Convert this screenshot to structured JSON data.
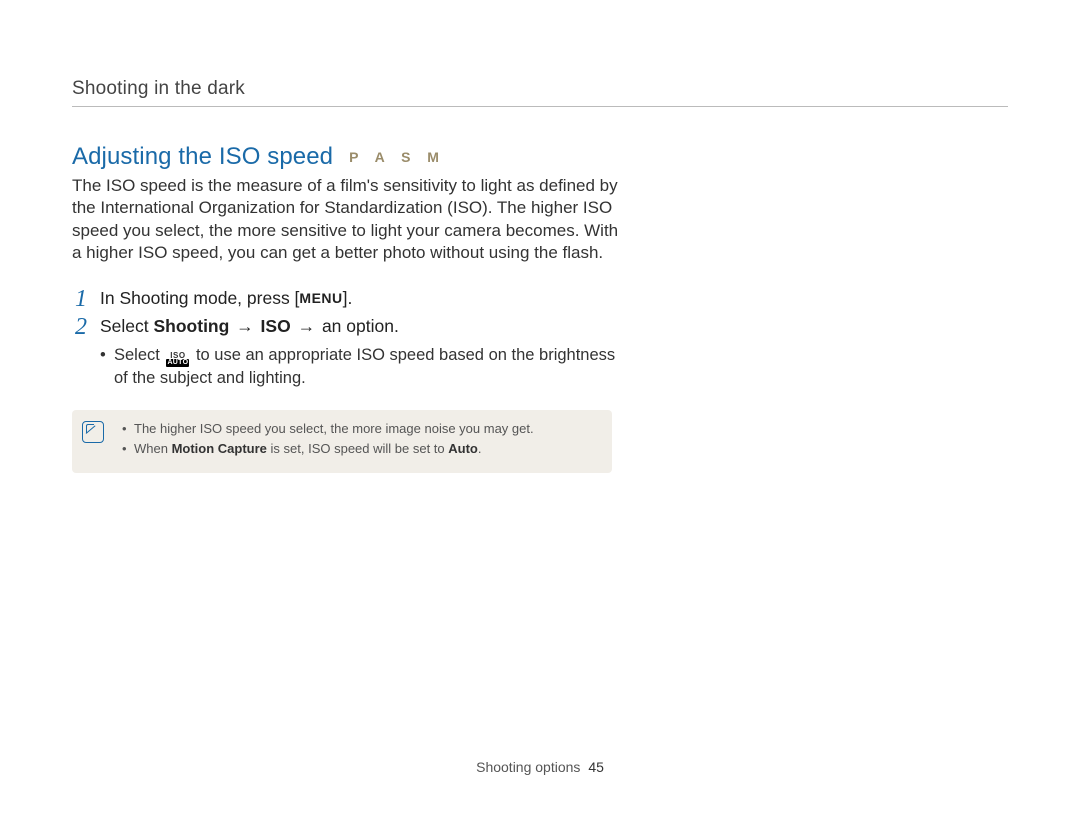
{
  "running_head": "Shooting in the dark",
  "section": {
    "title": "Adjusting the ISO speed",
    "modes": "P A S M",
    "intro": "The ISO speed is the measure of a film's sensitivity to light as defined by the International Organization for Standardization (ISO). The higher ISO speed you select, the more sensitive to light your camera becomes. With a higher ISO speed, you can get a better photo without using the flash."
  },
  "steps": [
    {
      "num": "1",
      "prefix": "In Shooting mode, press [",
      "keycap": "MENU",
      "suffix": "]."
    },
    {
      "num": "2",
      "prefix": "Select ",
      "bold1": "Shooting",
      "arrow1": " → ",
      "bold2": "ISO",
      "arrow2": " → ",
      "suffix": "an option.",
      "sub": {
        "pre": "Select ",
        "icon_top": "ISO",
        "icon_bottom": "AUTO",
        "post": " to use an appropriate ISO speed based on the brightness of the subject and lighting."
      }
    }
  ],
  "note": {
    "items": [
      {
        "text": "The higher ISO speed you select, the more image noise you may get."
      },
      {
        "pre": "When ",
        "bold1": "Motion Capture",
        "mid": " is set, ISO speed will be set to ",
        "bold2": "Auto",
        "post": "."
      }
    ]
  },
  "footer": {
    "section": "Shooting options",
    "page": "45"
  }
}
